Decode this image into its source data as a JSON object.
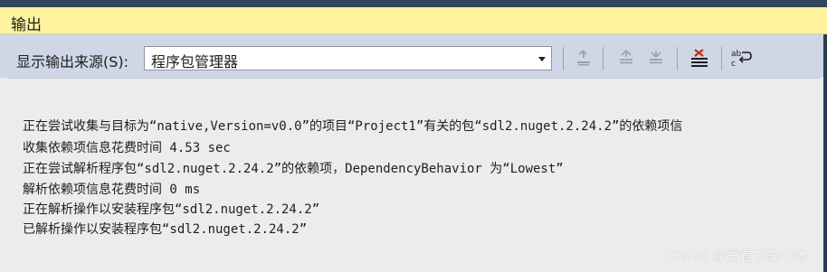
{
  "window": {
    "title": "输出"
  },
  "toolbar": {
    "source_label": "显示输出来源(S):",
    "source_value": "程序包管理器",
    "buttons": [
      {
        "name": "find-message-in-code-icon",
        "enabled": false
      },
      {
        "name": "go-to-previous-message-icon",
        "enabled": false
      },
      {
        "name": "go-to-next-message-icon",
        "enabled": false
      },
      {
        "name": "clear-all-icon",
        "enabled": true
      },
      {
        "name": "toggle-word-wrap-icon",
        "enabled": true
      }
    ]
  },
  "output": {
    "lines": [
      "正在尝试收集与目标为“native,Version=v0.0”的项目“Project1”有关的包“sdl2.nuget.2.24.2”的依赖项信",
      "收集依赖项信息花费时间 4.53 sec",
      "正在尝试解析程序包“sdl2.nuget.2.24.2”的依赖项，DependencyBehavior 为“Lowest”",
      "解析依赖项信息花费时间 0 ms",
      "正在解析操作以安装程序包“sdl2.nuget.2.24.2”",
      "已解析操作以安装程序包“sdl2.nuget.2.24.2”"
    ]
  },
  "watermark": "CSDN @爱看书的小沐",
  "colors": {
    "title_bar": "#fff29d",
    "toolbar": "#cfd6e5",
    "content_bg": "#ececef",
    "frame_dark": "#34465d"
  }
}
